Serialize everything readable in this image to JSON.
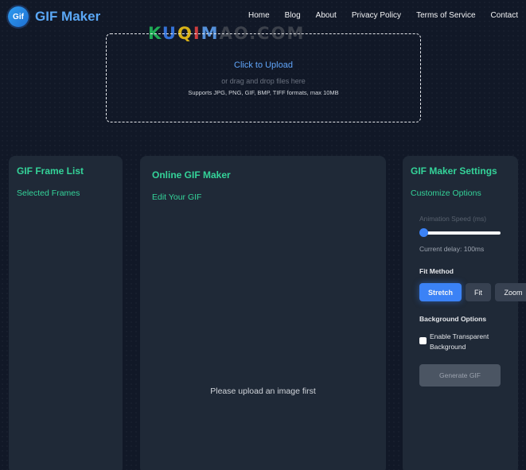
{
  "header": {
    "logo_badge": "Gif",
    "logo_text": "GIF Maker",
    "nav": [
      "Home",
      "Blog",
      "About",
      "Privacy Policy",
      "Terms of Service",
      "Contact"
    ]
  },
  "watermark": [
    "K",
    "U",
    "Q",
    "I",
    "M",
    "AO.COM"
  ],
  "upload": {
    "click_text": "Click to Upload",
    "drag_text": "or drag and drop files here",
    "formats_text": "Supports JPG, PNG, GIF, BMP, TIFF formats, max 10MB"
  },
  "frame_list": {
    "title": "GIF Frame List",
    "subtitle": "Selected Frames"
  },
  "editor": {
    "title": "Online GIF Maker",
    "subtitle": "Edit Your GIF",
    "placeholder": "Please upload an image first"
  },
  "settings": {
    "title": "GIF Maker Settings",
    "subtitle": "Customize Options",
    "speed_label": "Animation Speed (ms)",
    "speed_value": 100,
    "delay_text": "Current delay: 100ms",
    "fit_label": "Fit Method",
    "fit_options": [
      "Stretch",
      "Fit",
      "Zoom"
    ],
    "fit_selected": "Stretch",
    "bg_label": "Background Options",
    "transparent_label": "Enable Transparent Background",
    "transparent_checked": false,
    "generate_label": "Generate GIF"
  },
  "colors": {
    "accent": "#3b82f6",
    "heading": "#34d399",
    "panel": "#1f2937",
    "background": "#111827"
  }
}
